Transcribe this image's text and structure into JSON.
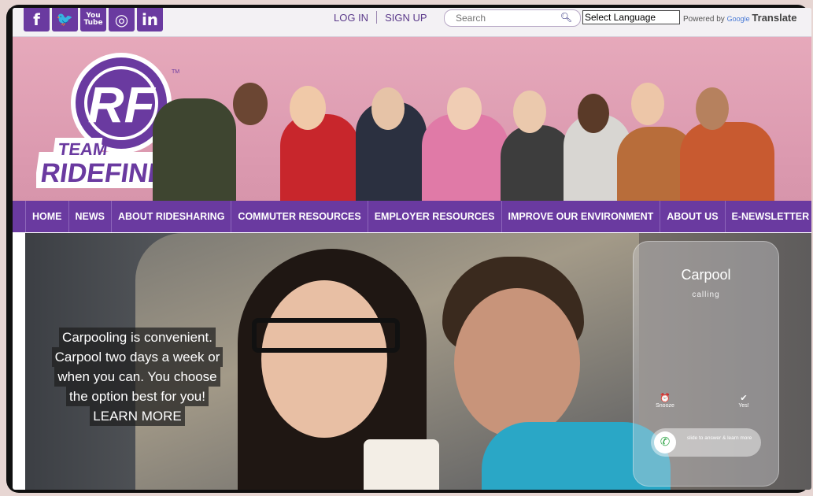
{
  "social": [
    {
      "icon": "facebook-icon",
      "glyph": "f"
    },
    {
      "icon": "twitter-icon",
      "glyph": "🐦"
    },
    {
      "icon": "youtube-icon",
      "glyph": "You Tube"
    },
    {
      "icon": "instagram-icon",
      "glyph": "◎"
    },
    {
      "icon": "linkedin-icon",
      "glyph": "in"
    }
  ],
  "auth": {
    "login": "LOG IN",
    "signup": "SIGN UP"
  },
  "search": {
    "placeholder": "Search"
  },
  "language": {
    "selected": "Select Language",
    "powered_prefix": "Powered by",
    "google": "Google",
    "translate": "Translate"
  },
  "brand": {
    "top": "TEAM",
    "name": "RIDEFINDERS",
    "monogram": "RF",
    "tm": "TM"
  },
  "nav": [
    "HOME",
    "NEWS",
    "ABOUT RIDESHARING",
    "COMMUTER RESOURCES",
    "EMPLOYER RESOURCES",
    "IMPROVE OUR ENVIRONMENT",
    "ABOUT US",
    "E-NEWSLETTER"
  ],
  "hero": {
    "lines": [
      "Carpooling is convenient.",
      "Carpool two days a week or",
      "when you can. You choose",
      "the option best for you!",
      "LEARN MORE"
    ]
  },
  "phone": {
    "title": "Carpool",
    "subtitle": "calling",
    "snooze": "Snooze",
    "yes": "Yes!",
    "slide": "slide to answer & learn more"
  },
  "colors": {
    "brand_purple": "#6a3aa0",
    "banner_pink": "#e0a0b5"
  }
}
